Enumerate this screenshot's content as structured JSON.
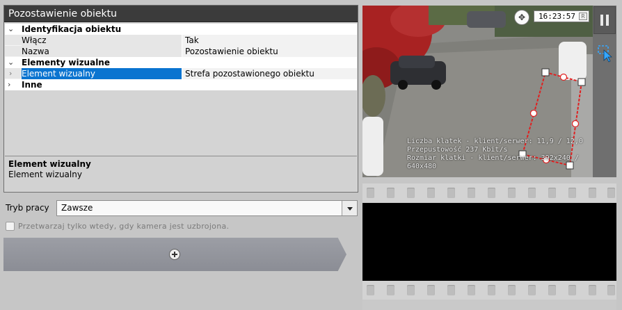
{
  "props_panel": {
    "title": "Pozostawienie obiektu",
    "categories": [
      {
        "twist": "⌄",
        "label": "Identyfikacja obiektu",
        "rows": [
          {
            "name": "Włącz",
            "value": "Tak"
          },
          {
            "name": "Nazwa",
            "value": "Pozostawienie obiektu"
          }
        ]
      },
      {
        "twist": "⌄",
        "label": "Elementy wizualne",
        "rows": [
          {
            "name": "Element wizualny",
            "value": "Strefa pozostawionego obiektu",
            "selected": true,
            "twist": "›"
          }
        ]
      },
      {
        "twist": "›",
        "label": "Inne",
        "rows": []
      }
    ],
    "description": {
      "title": "Element wizualny",
      "text": "Element wizualny"
    }
  },
  "mode": {
    "label": "Tryb pracy",
    "value": "Zawsze"
  },
  "checkbox": {
    "label": "Przetwarzaj tylko wtedy, gdy kamera jest uzbrojona.",
    "checked": false
  },
  "camera": {
    "time": "16:23:57",
    "r_badge": "R",
    "ptz_glyph": "✥",
    "stats": [
      "Liczba klatek - klient/serwer: 11,9 / 12,0",
      "Przepustowość 237 Kbit/s",
      "Rozmiar klatki - klient/serwer: 392x240 / 640x480"
    ]
  },
  "toolbar": {
    "pause_icon": "pause-icon",
    "zone_icon": "zone-edit-icon"
  },
  "colors": {
    "selection": "#0a74d0",
    "zone_line": "#e02020",
    "title_bar": "#3b3b3b",
    "add_bar": "#9c9ea5"
  }
}
